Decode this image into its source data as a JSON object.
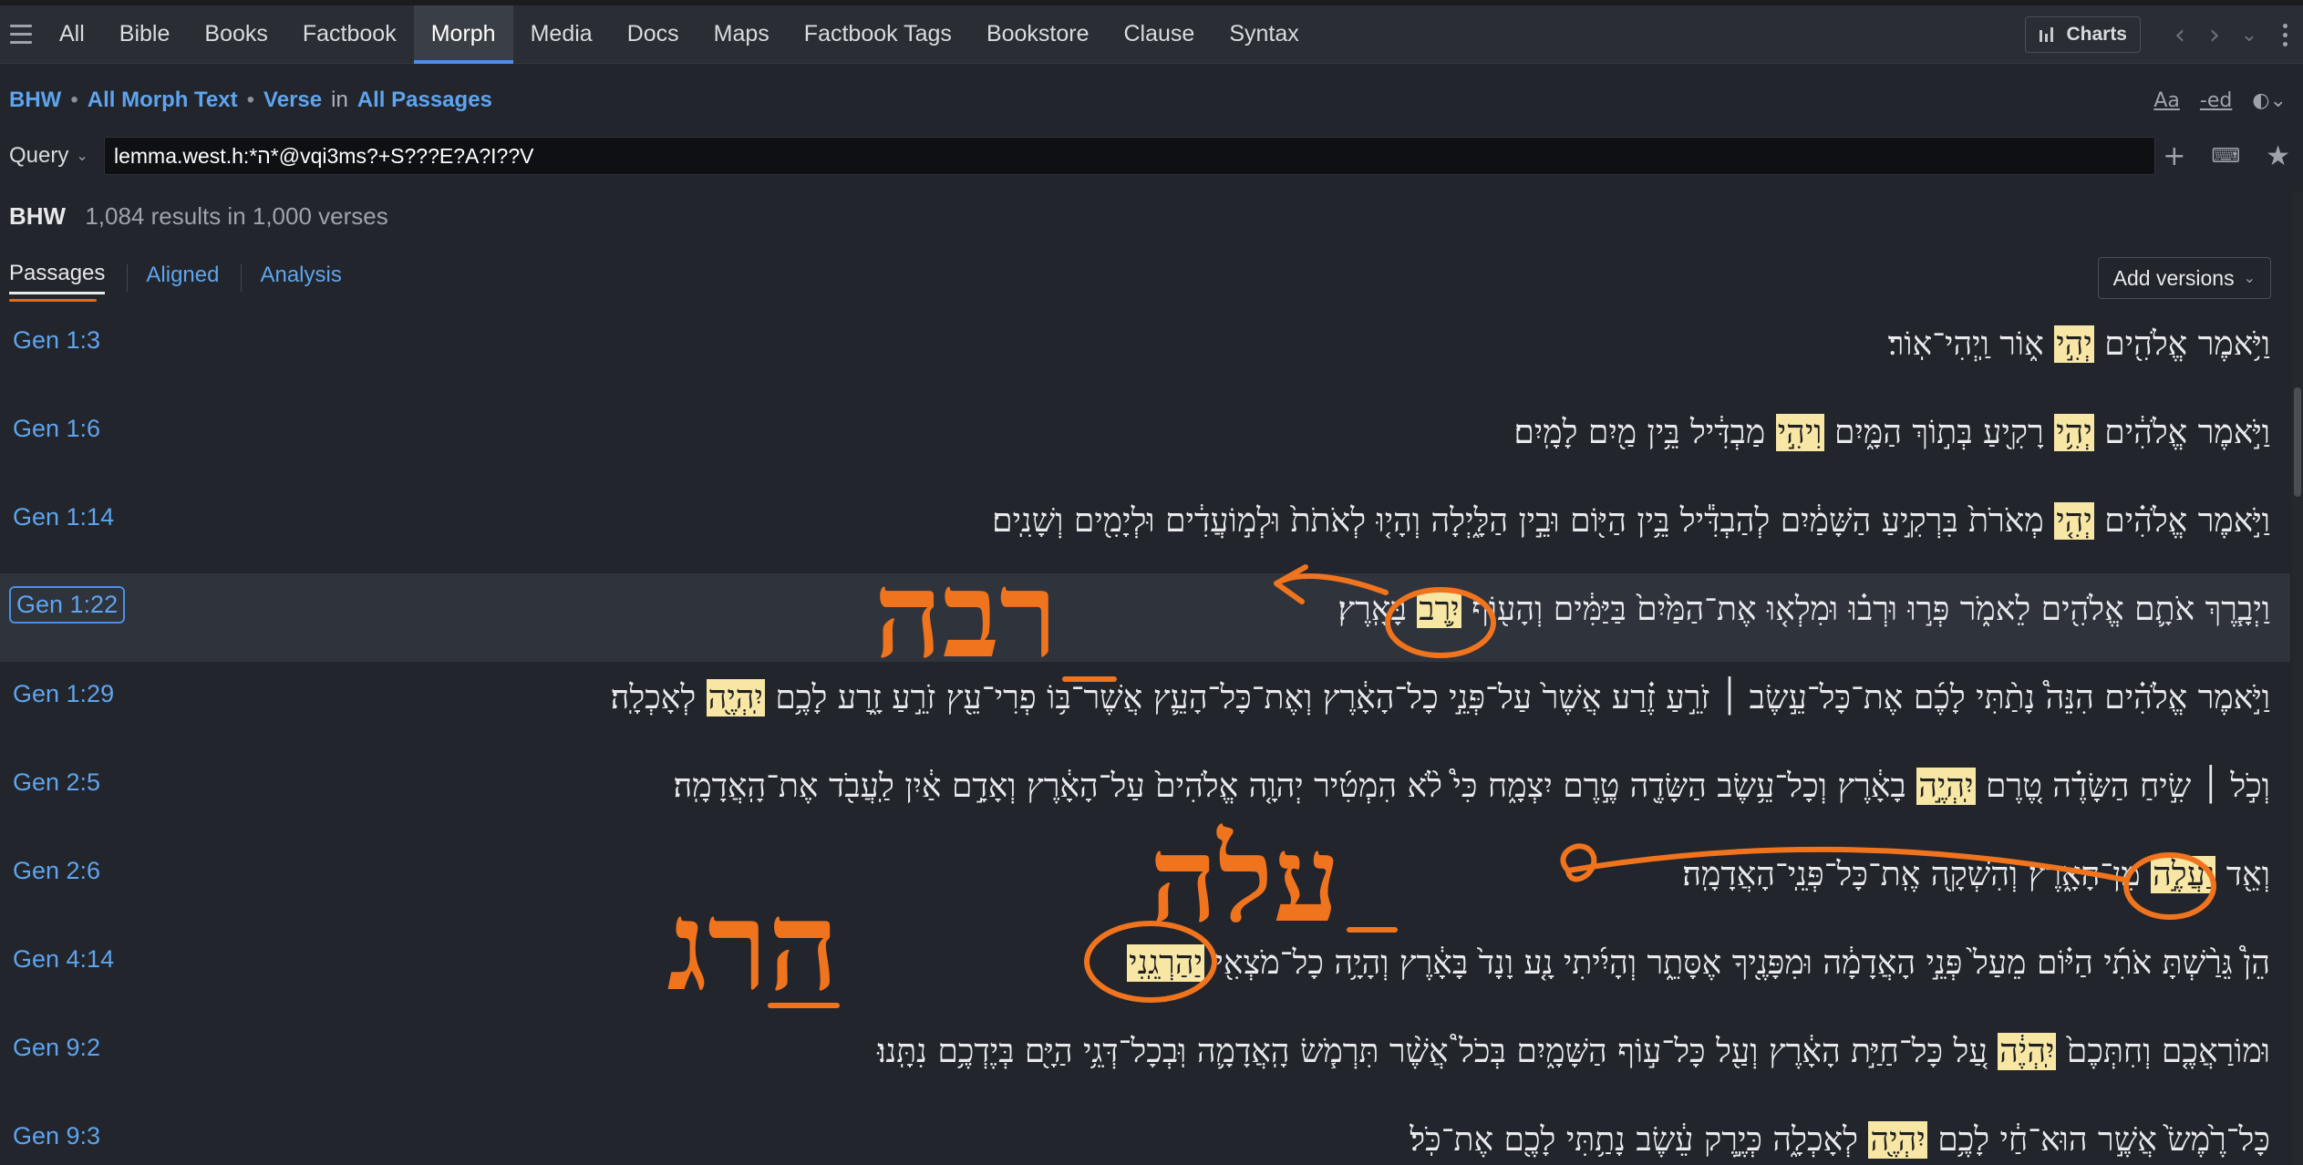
{
  "tabs": [
    "All",
    "Bible",
    "Books",
    "Factbook",
    "Morph",
    "Media",
    "Docs",
    "Maps",
    "Factbook Tags",
    "Bookstore",
    "Clause",
    "Syntax"
  ],
  "active_tab": "Morph",
  "charts_label": "Charts",
  "breadcrumb": {
    "source": "BHW",
    "text": "All Morph Text",
    "scope": "Verse",
    "in": "in",
    "range": "All Passages"
  },
  "crumb_tools": {
    "font": "Aa",
    "ed": "-ed"
  },
  "query": {
    "label": "Query",
    "value": "lemma.west.h:*ה*@vqi3ms?+S???E?A?I??V"
  },
  "results": {
    "source": "BHW",
    "count": "1,084 results in 1,000 verses"
  },
  "subtabs": [
    "Passages",
    "Aligned",
    "Analysis"
  ],
  "add_versions": "Add versions",
  "rows": [
    {
      "ref": "Gen 1:3",
      "pre": "וַיֹּ֥אמֶר אֱלֹהִ֖ים ",
      "hl": "יְהִ֣י",
      "mid": " א֑וֹר וַֽיְהִי־אֽוֹר׃",
      "hl2": "",
      "post": ""
    },
    {
      "ref": "Gen 1:6",
      "pre": "וַיֹּ֣אמֶר אֱלֹהִ֔ים ",
      "hl": "יְהִ֥י",
      "mid": " רָקִ֖יעַ בְּת֣וֹךְ הַמָּ֑יִם ",
      "hl2": "וִיהִ֣י",
      "post": " מַבְדִּ֔יל בֵּ֥ין מַ֖יִם לָמָֽיִם׃"
    },
    {
      "ref": "Gen 1:14",
      "pre": "וַיֹּ֣אמֶר אֱלֹהִ֗ים ",
      "hl": "יְהִ֤י",
      "mid": " מְאֹרֹת֙ בִּרְקִ֣יעַ הַשָּׁמַ֔יִם לְהַבְדִּ֕יל בֵּ֥ין הַיּ֖וֹם וּבֵ֣ין הַלָּ֑יְלָה וְהָי֤וּ לְאֹתֹת֙ וּלְמ֣וֹעֲדִ֔ים וּלְיָמִ֖ים וְשָׁנִֽים׃",
      "hl2": "",
      "post": ""
    },
    {
      "ref": "Gen 1:22",
      "pre": "וַיְבָ֧רֶךְ אֹתָ֛ם אֱלֹהִ֖ים לֵאמֹ֑ר פְּר֣וּ וּרְב֗וּ וּמִלְא֤וּ אֶת־הַמַּ֙יִם֙ בַּיַּמִּ֔ים וְהָע֖וֹף ",
      "hl": "יִ֥רֶב",
      "mid": " בָּאָֽרֶץ׃",
      "hl2": "",
      "post": ""
    },
    {
      "ref": "Gen 1:29",
      "pre": "וַיֹּ֣אמֶר אֱלֹהִ֗ים הִנֵּה֩ נָתַ֨תִּי לָכֶ֜ם אֶת־כָּל־עֵ֣שֶׂב ׀ זֹרֵ֣עַ זֶ֗רַע אֲשֶׁר֙ עַל־פְּנֵ֣י כָל־הָאָ֔רֶץ וְאֶת־כָּל־הָעֵ֛ץ אֲשֶׁר־בּ֥וֹ פְרִי־עֵ֖ץ זֹרֵ֣עַ זָ֑רַע לָכֶ֥ם ",
      "hl": "יִֽהְיֶ֖ה",
      "mid": " לְאָכְלָֽה׃",
      "hl2": "",
      "post": ""
    },
    {
      "ref": "Gen 2:5",
      "pre": "וְכֹ֣ל ׀ שִׂ֣יחַ הַשָּׂדֶ֗ה טֶ֚רֶם ",
      "hl": "יִֽהְיֶ֣ה",
      "mid": " בָאָ֔רֶץ וְכָל־עֵ֥שֶׂב הַשָּׂדֶ֖ה טֶ֣רֶם יִצְמָ֑ח כִּי֩ לֹ֨א הִמְטִ֜יר יְהוָ֤ה אֱלֹהִים֙ עַל־הָאָ֔רֶץ וְאָדָ֣ם אַ֔יִן לַֽעֲבֹ֖ד אֶת־הָֽאֲדָמָֽה׃",
      "hl2": "",
      "post": ""
    },
    {
      "ref": "Gen 2:6",
      "pre": "וְאֵ֖ד ",
      "hl": "יַעֲלֶ֣ה",
      "mid": " מִן־הָאָ֑רֶץ וְהִשְׁקָ֖ה אֶֽת־כָּל־פְּנֵֽי־הָאֲדָמָֽה׃",
      "hl2": "",
      "post": ""
    },
    {
      "ref": "Gen 4:14",
      "pre": "הֵן֩ גֵּרַ֨שְׁתָּ אֹתִ֜י הַיּ֗וֹם מֵעַל֙ פְּנֵ֣י הָאֲדָמָ֔ה וּמִפָּנֶ֖יךָ אֶסָּתֵ֑ר וְהָיִ֜יתִי נָ֤ע וָנָד֙ בָּאָ֔רֶץ וְהָיָ֥ה כָל־מֹצְאִ֖י ",
      "hl": "יַהַרְגֵֽנִי",
      "mid": "׃",
      "hl2": "",
      "post": ""
    },
    {
      "ref": "Gen 9:2",
      "pre": "וּמוֹרַאֲכֶ֤ם וְחִתְּכֶם֙ ",
      "hl": "יִֽהְיֶ֔ה",
      "mid": " עַ֚ל כָּל־חַיַּ֣ת הָאָ֔רֶץ וְעַ֖ל כָּל־ע֣וֹף הַשָּׁמָ֑יִם בְּכֹל֩ אֲשֶׁ֨ר תִּרְמֹ֧שׂ הָֽאֲדָמָ֛ה וּֽבְכָל־דְּגֵ֥י הַיָּ֖ם בְּיֶדְכֶ֥ם נִתָּֽנוּ׃",
      "hl2": "",
      "post": ""
    },
    {
      "ref": "Gen 9:3",
      "pre": "כָּל־רֶ֙מֶשׂ֙ אֲשֶׁ֣ר הוּא־חַ֔י לָכֶ֥ם ",
      "hl": "יִהְיֶ֖ה",
      "mid": " לְאָכְלָ֑ה כְּיֶ֣רֶק עֵ֔שֶׂב נָתַ֥תִּי לָכֶ֖ם אֶת־כֹּֽל׃",
      "hl2": "",
      "post": ""
    }
  ],
  "annotations": {
    "root_1": "רבה",
    "root_2": "עלה",
    "root_3": "הרג",
    "color": "#f0731e"
  },
  "colors": {
    "accent": "#5ea4ee",
    "highlight": "#f8e7a4",
    "active_underline": "#4a90e2",
    "background": "#22252b"
  }
}
